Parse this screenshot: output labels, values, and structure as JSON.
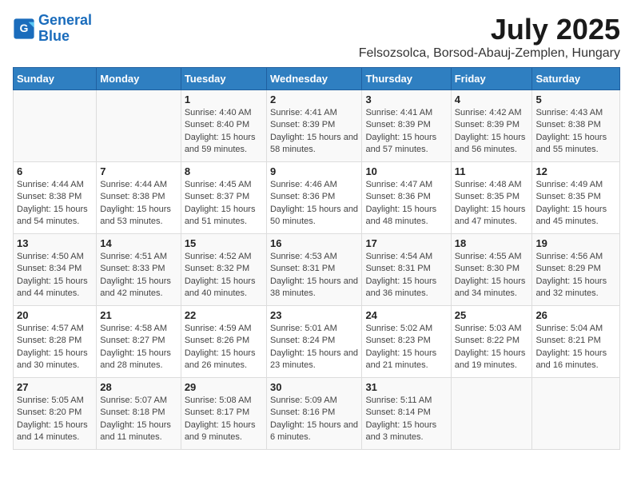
{
  "header": {
    "logo_line1": "General",
    "logo_line2": "Blue",
    "title": "July 2025",
    "subtitle": "Felsozsolca, Borsod-Abauj-Zemplen, Hungary"
  },
  "days_of_week": [
    "Sunday",
    "Monday",
    "Tuesday",
    "Wednesday",
    "Thursday",
    "Friday",
    "Saturday"
  ],
  "weeks": [
    [
      {
        "day": "",
        "info": ""
      },
      {
        "day": "",
        "info": ""
      },
      {
        "day": "1",
        "info": "Sunrise: 4:40 AM\nSunset: 8:40 PM\nDaylight: 15 hours and 59 minutes."
      },
      {
        "day": "2",
        "info": "Sunrise: 4:41 AM\nSunset: 8:39 PM\nDaylight: 15 hours and 58 minutes."
      },
      {
        "day": "3",
        "info": "Sunrise: 4:41 AM\nSunset: 8:39 PM\nDaylight: 15 hours and 57 minutes."
      },
      {
        "day": "4",
        "info": "Sunrise: 4:42 AM\nSunset: 8:39 PM\nDaylight: 15 hours and 56 minutes."
      },
      {
        "day": "5",
        "info": "Sunrise: 4:43 AM\nSunset: 8:38 PM\nDaylight: 15 hours and 55 minutes."
      }
    ],
    [
      {
        "day": "6",
        "info": "Sunrise: 4:44 AM\nSunset: 8:38 PM\nDaylight: 15 hours and 54 minutes."
      },
      {
        "day": "7",
        "info": "Sunrise: 4:44 AM\nSunset: 8:38 PM\nDaylight: 15 hours and 53 minutes."
      },
      {
        "day": "8",
        "info": "Sunrise: 4:45 AM\nSunset: 8:37 PM\nDaylight: 15 hours and 51 minutes."
      },
      {
        "day": "9",
        "info": "Sunrise: 4:46 AM\nSunset: 8:36 PM\nDaylight: 15 hours and 50 minutes."
      },
      {
        "day": "10",
        "info": "Sunrise: 4:47 AM\nSunset: 8:36 PM\nDaylight: 15 hours and 48 minutes."
      },
      {
        "day": "11",
        "info": "Sunrise: 4:48 AM\nSunset: 8:35 PM\nDaylight: 15 hours and 47 minutes."
      },
      {
        "day": "12",
        "info": "Sunrise: 4:49 AM\nSunset: 8:35 PM\nDaylight: 15 hours and 45 minutes."
      }
    ],
    [
      {
        "day": "13",
        "info": "Sunrise: 4:50 AM\nSunset: 8:34 PM\nDaylight: 15 hours and 44 minutes."
      },
      {
        "day": "14",
        "info": "Sunrise: 4:51 AM\nSunset: 8:33 PM\nDaylight: 15 hours and 42 minutes."
      },
      {
        "day": "15",
        "info": "Sunrise: 4:52 AM\nSunset: 8:32 PM\nDaylight: 15 hours and 40 minutes."
      },
      {
        "day": "16",
        "info": "Sunrise: 4:53 AM\nSunset: 8:31 PM\nDaylight: 15 hours and 38 minutes."
      },
      {
        "day": "17",
        "info": "Sunrise: 4:54 AM\nSunset: 8:31 PM\nDaylight: 15 hours and 36 minutes."
      },
      {
        "day": "18",
        "info": "Sunrise: 4:55 AM\nSunset: 8:30 PM\nDaylight: 15 hours and 34 minutes."
      },
      {
        "day": "19",
        "info": "Sunrise: 4:56 AM\nSunset: 8:29 PM\nDaylight: 15 hours and 32 minutes."
      }
    ],
    [
      {
        "day": "20",
        "info": "Sunrise: 4:57 AM\nSunset: 8:28 PM\nDaylight: 15 hours and 30 minutes."
      },
      {
        "day": "21",
        "info": "Sunrise: 4:58 AM\nSunset: 8:27 PM\nDaylight: 15 hours and 28 minutes."
      },
      {
        "day": "22",
        "info": "Sunrise: 4:59 AM\nSunset: 8:26 PM\nDaylight: 15 hours and 26 minutes."
      },
      {
        "day": "23",
        "info": "Sunrise: 5:01 AM\nSunset: 8:24 PM\nDaylight: 15 hours and 23 minutes."
      },
      {
        "day": "24",
        "info": "Sunrise: 5:02 AM\nSunset: 8:23 PM\nDaylight: 15 hours and 21 minutes."
      },
      {
        "day": "25",
        "info": "Sunrise: 5:03 AM\nSunset: 8:22 PM\nDaylight: 15 hours and 19 minutes."
      },
      {
        "day": "26",
        "info": "Sunrise: 5:04 AM\nSunset: 8:21 PM\nDaylight: 15 hours and 16 minutes."
      }
    ],
    [
      {
        "day": "27",
        "info": "Sunrise: 5:05 AM\nSunset: 8:20 PM\nDaylight: 15 hours and 14 minutes."
      },
      {
        "day": "28",
        "info": "Sunrise: 5:07 AM\nSunset: 8:18 PM\nDaylight: 15 hours and 11 minutes."
      },
      {
        "day": "29",
        "info": "Sunrise: 5:08 AM\nSunset: 8:17 PM\nDaylight: 15 hours and 9 minutes."
      },
      {
        "day": "30",
        "info": "Sunrise: 5:09 AM\nSunset: 8:16 PM\nDaylight: 15 hours and 6 minutes."
      },
      {
        "day": "31",
        "info": "Sunrise: 5:11 AM\nSunset: 8:14 PM\nDaylight: 15 hours and 3 minutes."
      },
      {
        "day": "",
        "info": ""
      },
      {
        "day": "",
        "info": ""
      }
    ]
  ]
}
